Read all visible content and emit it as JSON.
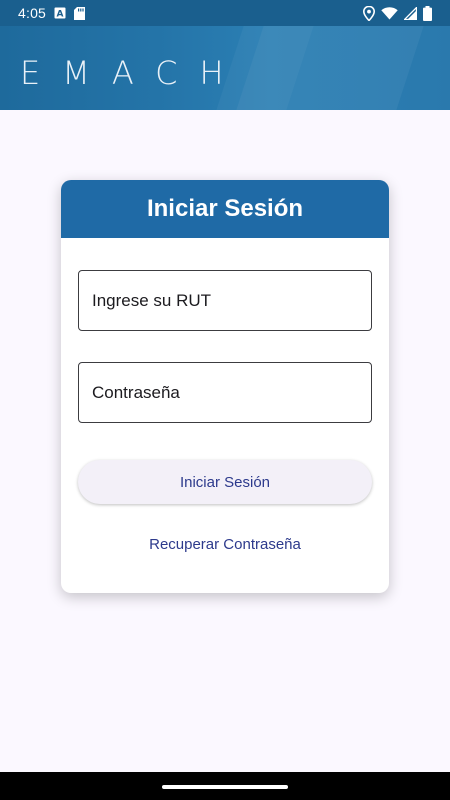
{
  "status_bar": {
    "time": "4:05",
    "icons_left": [
      "a-notification-icon",
      "sd-card-icon"
    ],
    "icons_right": [
      "location-icon",
      "wifi-icon",
      "signal-icon",
      "battery-icon"
    ]
  },
  "header": {
    "logo_text": "EMACH"
  },
  "login": {
    "title": "Iniciar Sesión",
    "rut_placeholder": "Ingrese su RUT",
    "password_placeholder": "Contraseña",
    "submit_label": "Iniciar Sesión",
    "recover_label": "Recuperar Contraseña"
  },
  "colors": {
    "header_blue": "#1f6aa6",
    "link_indigo": "#2d3a8c",
    "background": "#fbf8ff"
  }
}
